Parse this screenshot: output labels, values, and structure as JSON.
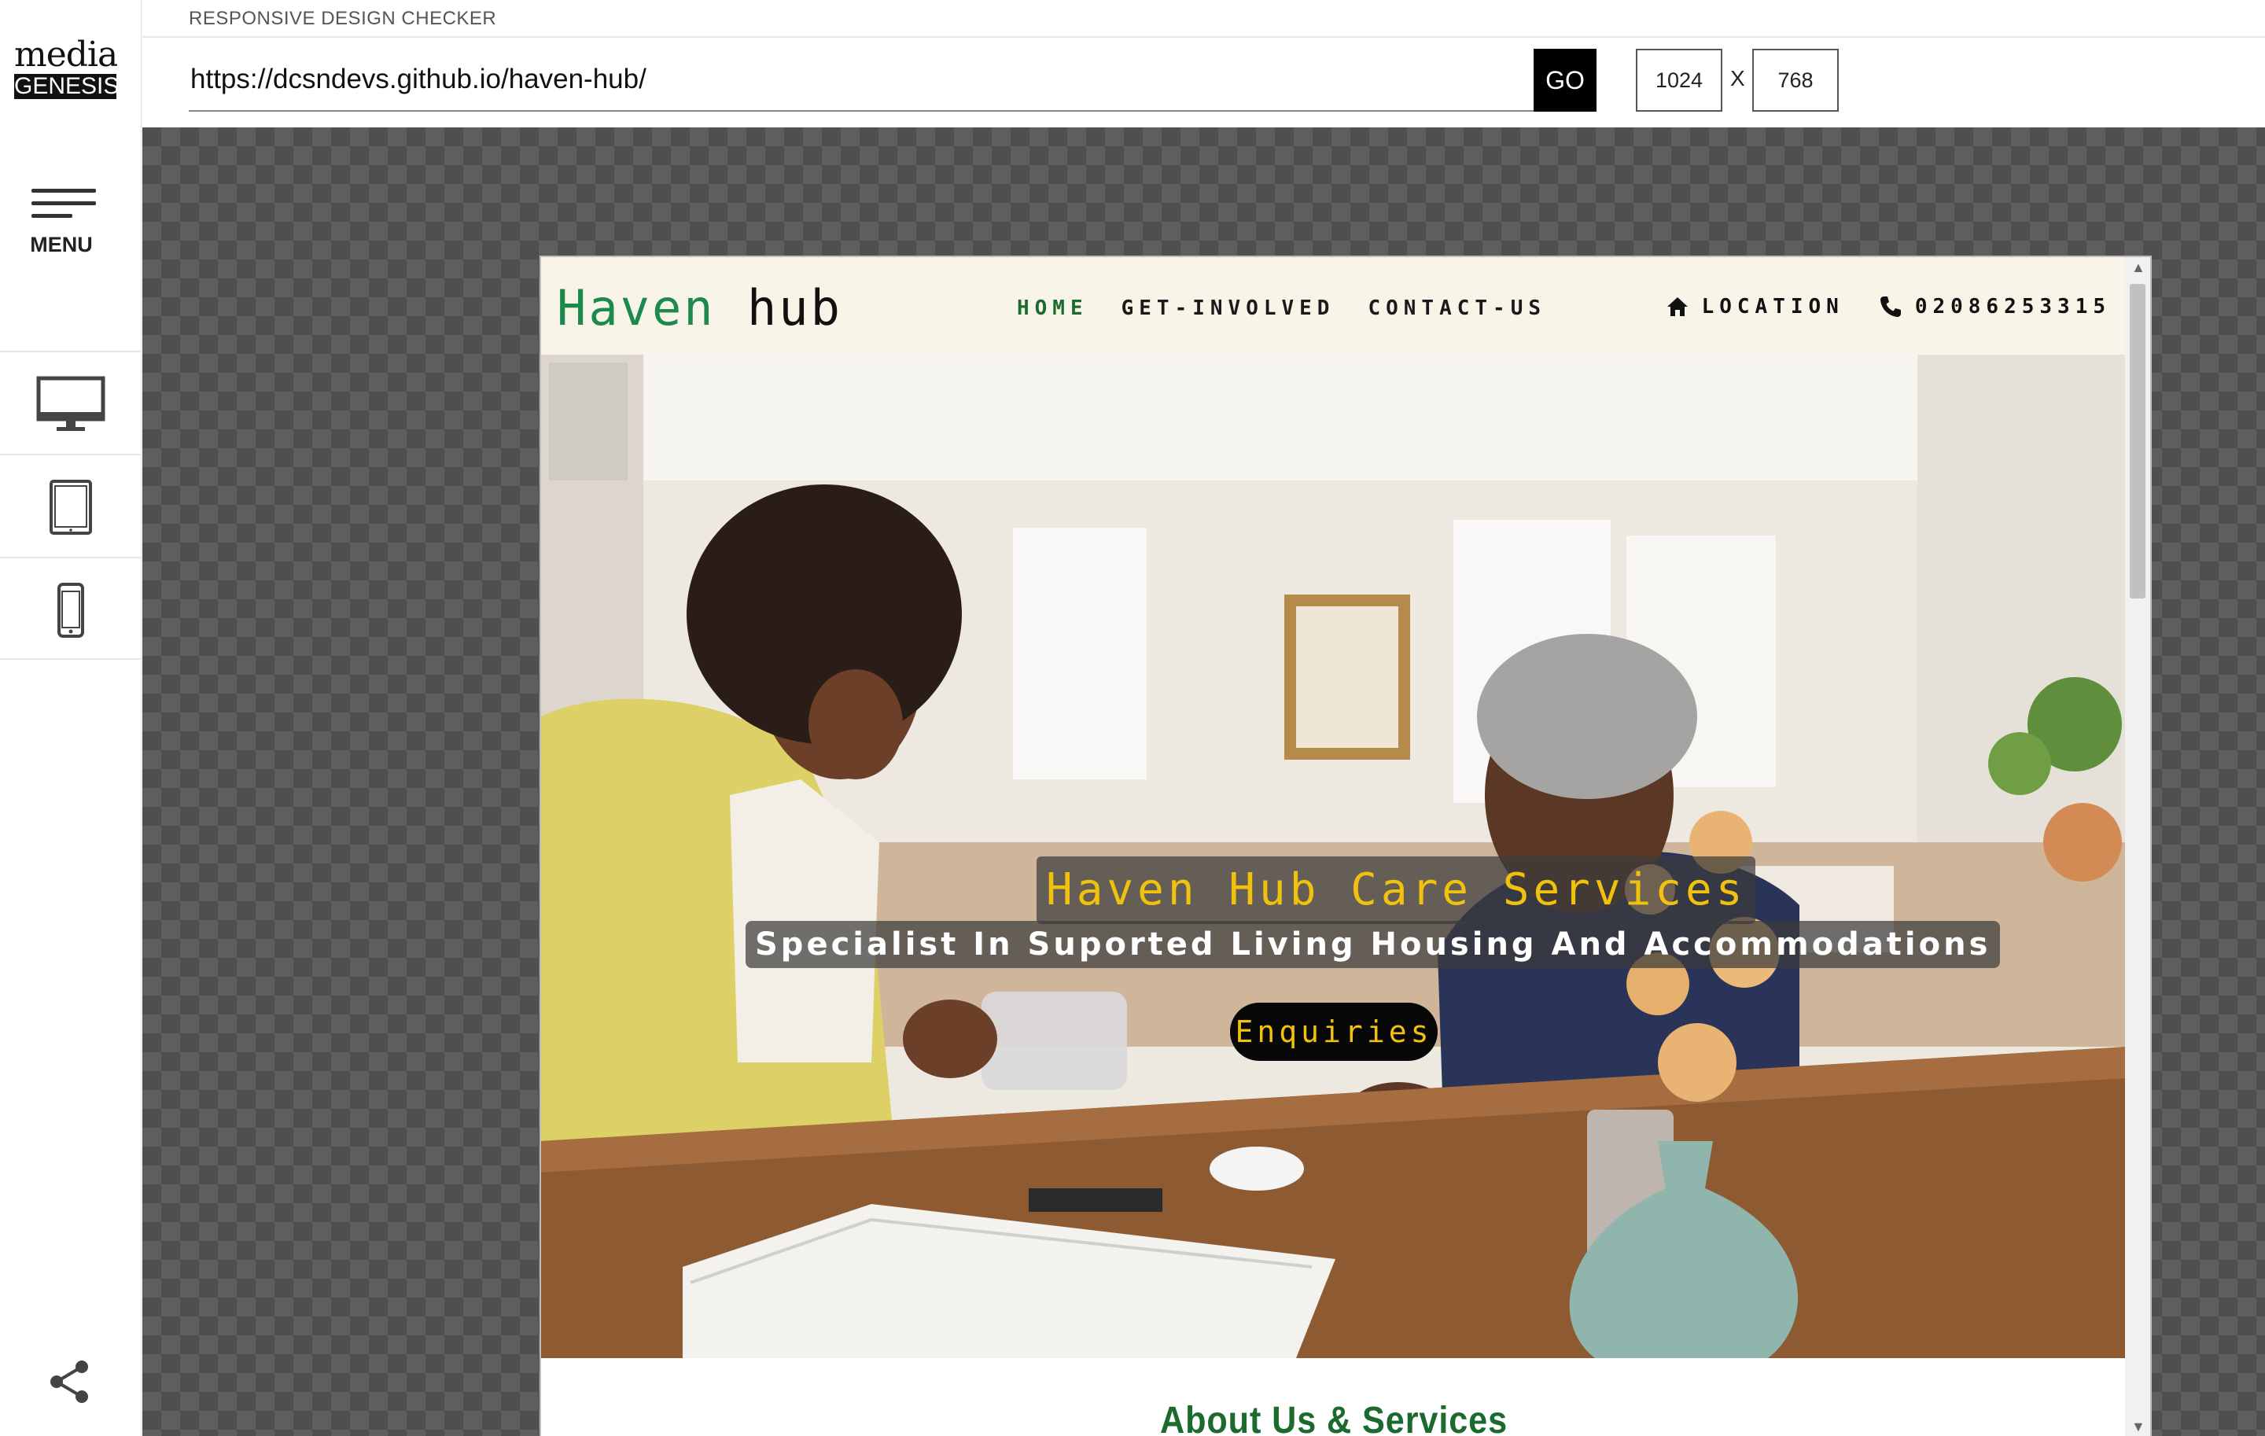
{
  "app": {
    "logo_top": "media",
    "logo_bottom": "GENESIS",
    "title": "RESPONSIVE DESIGN CHECKER",
    "menu_label": "MENU"
  },
  "toolbar": {
    "url": "https://dcsndevs.github.io/haven-hub/",
    "go_label": "GO",
    "width": "1024",
    "height": "768",
    "x_label": "X"
  },
  "devices": [
    {
      "name": "desktop-icon"
    },
    {
      "name": "tablet-icon"
    },
    {
      "name": "phone-icon"
    }
  ],
  "site": {
    "brand_first": "Haven",
    "brand_second": "hub",
    "nav": [
      "HOME",
      "GET-INVOLVED",
      "CONTACT-US"
    ],
    "location": "LOCATION",
    "phone": "02086253315",
    "hero_title": "Haven Hub Care Services",
    "hero_subtitle": "Specialist In Suported Living Housing And Accommodations",
    "cta": "Enquiries",
    "section_title": "About Us & Services"
  },
  "colors": {
    "brand_green": "#1b8a4c",
    "nav_home": "#1b6b2e",
    "hero_yellow": "#f0c20e",
    "nav_bg": "#f8f4e8"
  }
}
